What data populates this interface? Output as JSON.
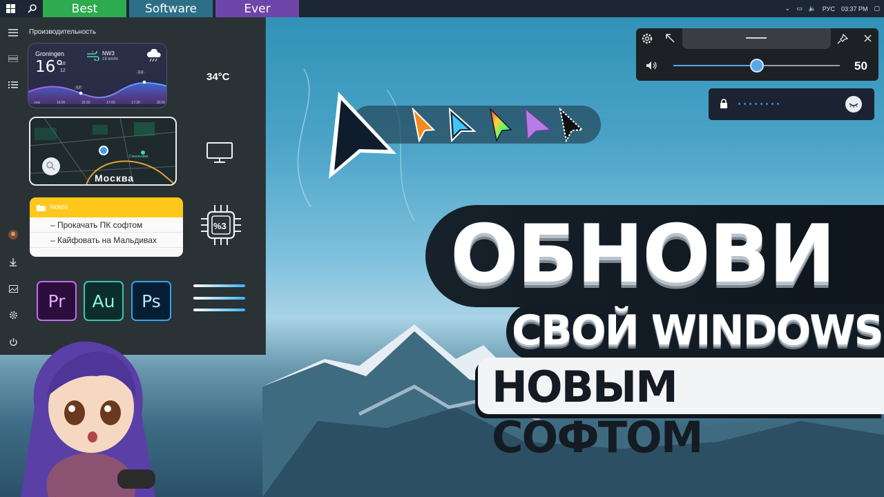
{
  "taskbar": {
    "tabs": [
      "Best",
      "Software",
      "Ever"
    ],
    "tray": {
      "lang": "РУС",
      "time": "03:37 PM"
    }
  },
  "start_panel": {
    "title": "Производительность",
    "weather": {
      "city": "Groningen",
      "temp": "16°",
      "high": "18",
      "low": "12",
      "wind_dir": "NW3",
      "wind_speed": "19 km/hr",
      "point_left": "1,2",
      "point_right": "2,3",
      "times": [
        "now",
        "16:00",
        "16:30",
        "17:00",
        "17:30",
        "18:00"
      ]
    },
    "temperature": "34°C",
    "map": {
      "city": "Москва",
      "poi": "Сокольники"
    },
    "notes": {
      "title": "Notes",
      "items": [
        "– Прокачать ПК софтом",
        "– Кайфовать на Мальдивах"
      ]
    },
    "cpu_label": "%3",
    "apps": [
      "Pr",
      "Au",
      "Ps"
    ]
  },
  "volume": {
    "value": "50",
    "level": 0.5
  },
  "headline": {
    "line1": "ОБНОВИ",
    "line2": "СВОЙ WINDOWS",
    "line3": "НОВЫМ СОФТОМ"
  },
  "colors": {
    "tab_best": "#2eaa4f",
    "tab_software": "#2d6f86",
    "tab_ever": "#6e45a8",
    "accent": "#55a8ea",
    "notes_header": "#ffc81a"
  },
  "icons": [
    "windows-logo-icon",
    "search-icon",
    "hamburger-icon",
    "gear-icon",
    "power-icon",
    "download-icon",
    "lock-icon",
    "volume-icon",
    "pin-icon",
    "close-icon",
    "monitor-icon",
    "cpu-icon"
  ]
}
